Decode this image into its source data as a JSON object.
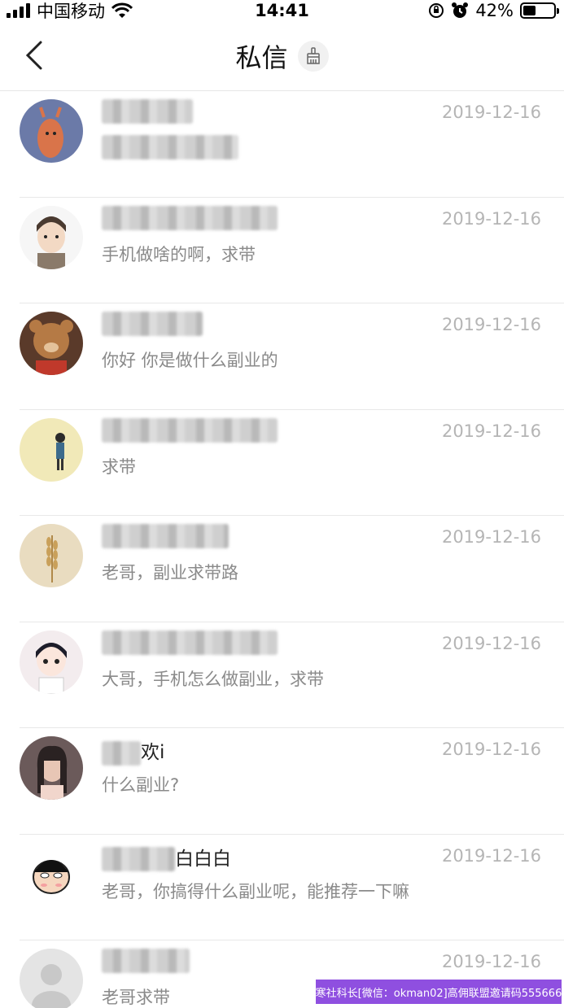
{
  "status_bar": {
    "carrier": "中国移动",
    "time": "14:41",
    "battery_percent": "42%",
    "battery_level": 0.42
  },
  "nav": {
    "title": "私信",
    "back_icon": "chevron-left-icon",
    "clear_icon": "broom-icon"
  },
  "conversations": [
    {
      "name": "",
      "date": "2019-12-16",
      "message": "",
      "avatar": "cartoon-deer"
    },
    {
      "name": "",
      "date": "2019-12-16",
      "message": "手机做啥的啊，求带",
      "avatar": "cartoon-boy"
    },
    {
      "name": "",
      "date": "2019-12-16",
      "message": "你好 你是做什么副业的",
      "avatar": "teddy-bear"
    },
    {
      "name": "",
      "date": "2019-12-16",
      "message": "求带",
      "avatar": "standing-figure"
    },
    {
      "name": "",
      "date": "2019-12-16",
      "message": "老哥，副业求带路",
      "avatar": "wheat"
    },
    {
      "name": "",
      "date": "2019-12-16",
      "message": "大哥，手机怎么做副业，求带",
      "avatar": "anime-boy"
    },
    {
      "name": "欢i",
      "date": "2019-12-16",
      "message": "什么副业?",
      "avatar": "girl-photo"
    },
    {
      "name": "白白白",
      "date": "2019-12-16",
      "message": "老哥，你搞得什么副业呢，能推荐一下嘛",
      "avatar": "crayon-shin"
    },
    {
      "name": "",
      "date": "2019-12-16",
      "message": "老哥求带",
      "avatar": "default-gray"
    }
  ],
  "watermark": "寒社科长[微信：okman02]高佣联盟邀请码555666"
}
